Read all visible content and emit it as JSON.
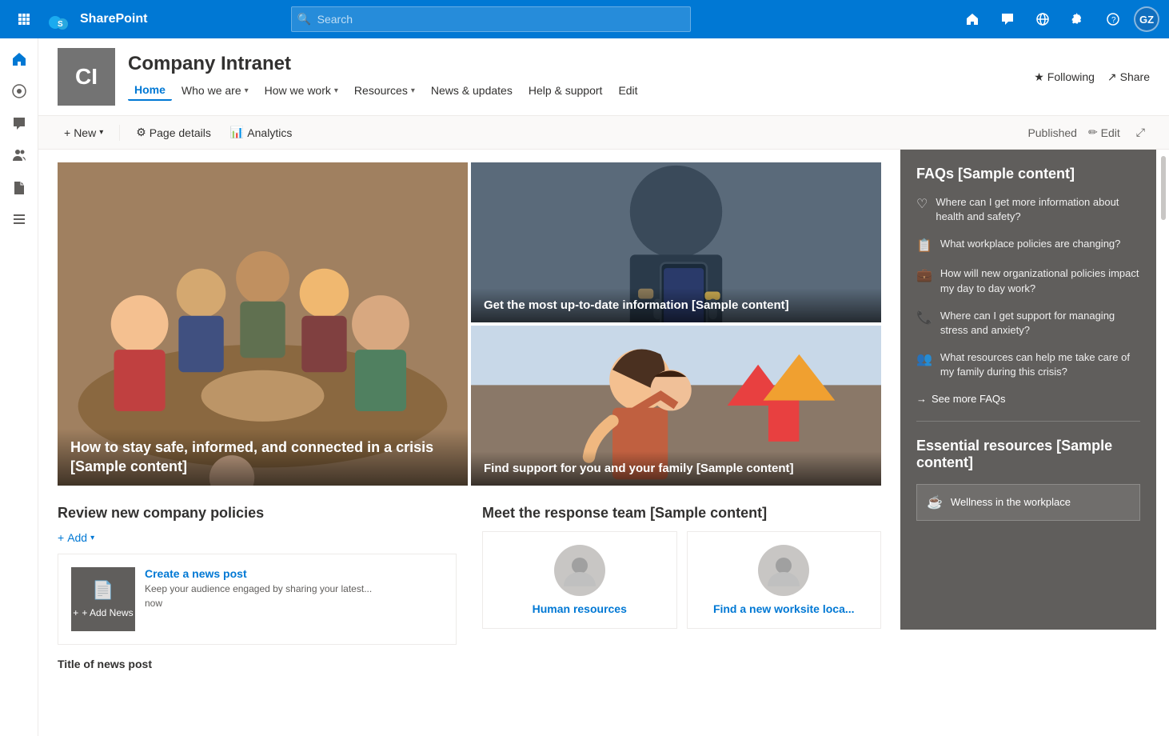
{
  "topnav": {
    "appname": "SharePoint",
    "search_placeholder": "Search",
    "user_initials": "GZ"
  },
  "site": {
    "logo_text": "CI",
    "title": "Company Intranet",
    "nav_items": [
      {
        "label": "Home",
        "active": true
      },
      {
        "label": "Who we are",
        "has_chevron": true
      },
      {
        "label": "How we work",
        "has_chevron": true
      },
      {
        "label": "Resources",
        "has_chevron": true
      },
      {
        "label": "News & updates"
      },
      {
        "label": "Help & support"
      },
      {
        "label": "Edit"
      }
    ],
    "actions": {
      "following": "Following",
      "share": "Share"
    }
  },
  "toolbar": {
    "new_label": "New",
    "page_details_label": "Page details",
    "analytics_label": "Analytics",
    "published_label": "Published",
    "edit_label": "Edit"
  },
  "hero": {
    "left": {
      "title": "How to stay safe, informed, and connected in a crisis [Sample content]"
    },
    "right_top": {
      "title": "Get the most up-to-date information [Sample content]"
    },
    "right_bottom": {
      "title": "Find support for you and your family [Sample content]"
    }
  },
  "sections": {
    "policies": {
      "title": "Review new company policies",
      "add_label": "Add",
      "news": {
        "post_title": "Create a news post",
        "post_desc": "Keep your audience engaged by sharing your latest...",
        "post_time": "now",
        "add_news_label": "+ Add News"
      },
      "news_title_label": "Title of news post"
    },
    "team": {
      "title": "Meet the response team [Sample content]",
      "people": [
        {
          "name": "Human resources",
          "id": "hr"
        },
        {
          "name": "Find a new worksite loca...",
          "id": "worksite"
        }
      ]
    }
  },
  "faqs": {
    "title": "FAQs [Sample content]",
    "items": [
      {
        "icon": "❤",
        "text": "Where can I get more information about health and safety?"
      },
      {
        "icon": "📋",
        "text": "What workplace policies are changing?"
      },
      {
        "icon": "💼",
        "text": "How will new organizational policies impact my day to day work?"
      },
      {
        "icon": "📞",
        "text": "Where can I get support for managing stress and anxiety?"
      },
      {
        "icon": "👥",
        "text": "What resources can help me take care of my family during this crisis?"
      }
    ],
    "see_more": "See more FAQs"
  },
  "essential": {
    "title": "Essential resources [Sample content]",
    "items": [
      {
        "icon": "☕",
        "label": "Wellness in the workplace"
      }
    ]
  }
}
